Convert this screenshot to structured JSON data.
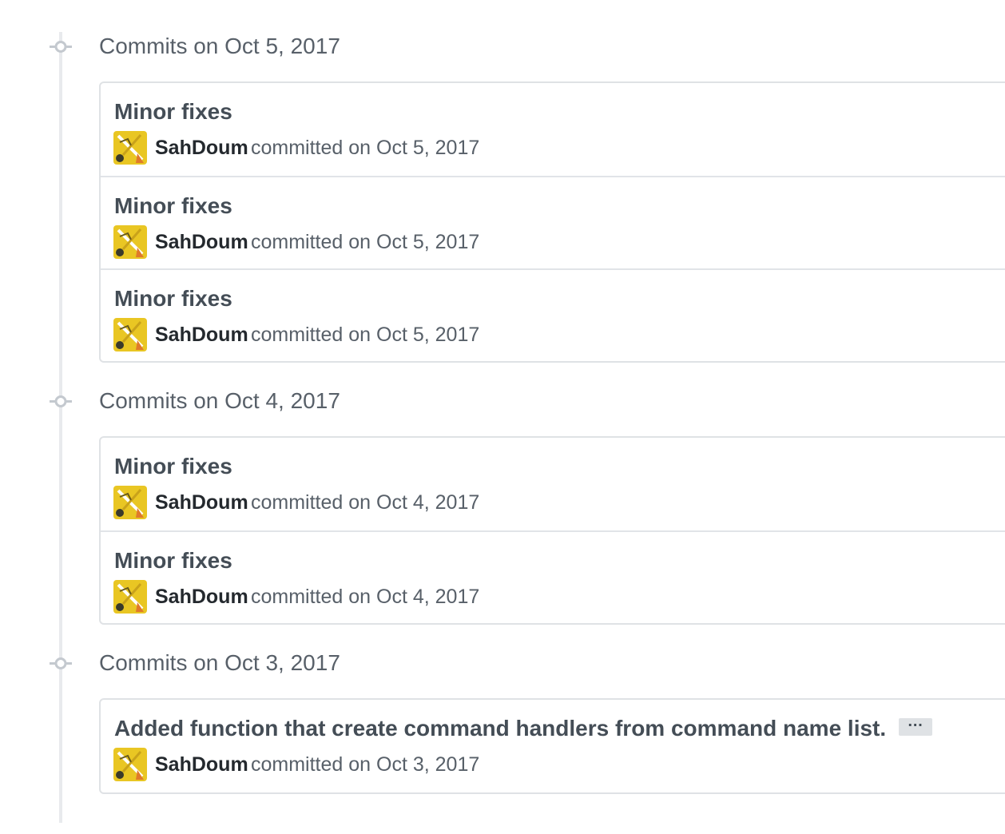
{
  "timeline": {
    "groups": [
      {
        "title": "Commits on Oct 5, 2017",
        "commits": [
          {
            "title": "Minor fixes",
            "author": "SahDoum",
            "meta": "committed on Oct 5, 2017"
          },
          {
            "title": "Minor fixes",
            "author": "SahDoum",
            "meta": "committed on Oct 5, 2017"
          },
          {
            "title": "Minor fixes",
            "author": "SahDoum",
            "meta": "committed on Oct 5, 2017"
          }
        ]
      },
      {
        "title": "Commits on Oct 4, 2017",
        "commits": [
          {
            "title": "Minor fixes",
            "author": "SahDoum",
            "meta": "committed on Oct 4, 2017"
          },
          {
            "title": "Minor fixes",
            "author": "SahDoum",
            "meta": "committed on Oct 4, 2017"
          }
        ]
      },
      {
        "title": "Commits on Oct 3, 2017",
        "commits": [
          {
            "title": "Added function that create command handlers from command name list.",
            "author": "SahDoum",
            "meta": "committed on Oct 3, 2017",
            "has_ellipsis": true,
            "ellipsis": "…"
          }
        ]
      }
    ]
  },
  "colors": {
    "timeline_line": "#e8eaed",
    "border": "#dfe2e5",
    "muted_text": "#586069",
    "title_text": "#444d56",
    "author_text": "#24292e",
    "avatar_bg": "#e9c623"
  },
  "icons": {
    "group_marker": "git-commit-icon",
    "avatar": "avatar-icon"
  }
}
